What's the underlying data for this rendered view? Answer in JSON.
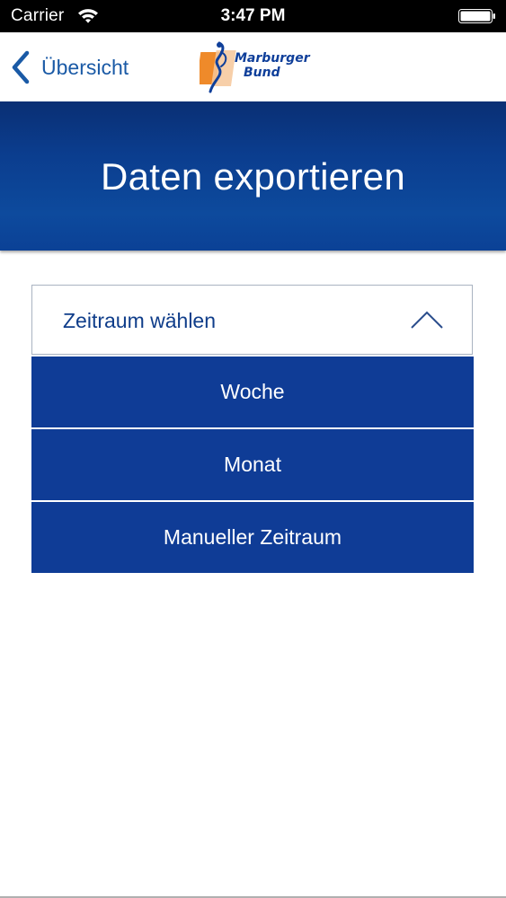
{
  "status_bar": {
    "carrier": "Carrier",
    "time": "3:47 PM",
    "wifi_icon": "wifi-icon",
    "battery_icon": "battery-icon"
  },
  "nav_bar": {
    "back_label": "Übersicht",
    "back_icon": "chevron-left-icon",
    "logo": {
      "line1": "Marburger",
      "line2": "Bund"
    }
  },
  "header": {
    "title": "Daten exportieren"
  },
  "dropdown": {
    "label": "Zeitraum wählen",
    "icon": "chevron-up-icon",
    "expanded": true,
    "options": [
      {
        "label": "Woche"
      },
      {
        "label": "Monat"
      },
      {
        "label": "Manueller Zeitraum"
      }
    ]
  },
  "colors": {
    "accent_blue": "#0f3c96",
    "link_blue": "#1a5aa6",
    "header_blue": "#0b3d8e",
    "logo_orange": "#ef8a2a"
  }
}
